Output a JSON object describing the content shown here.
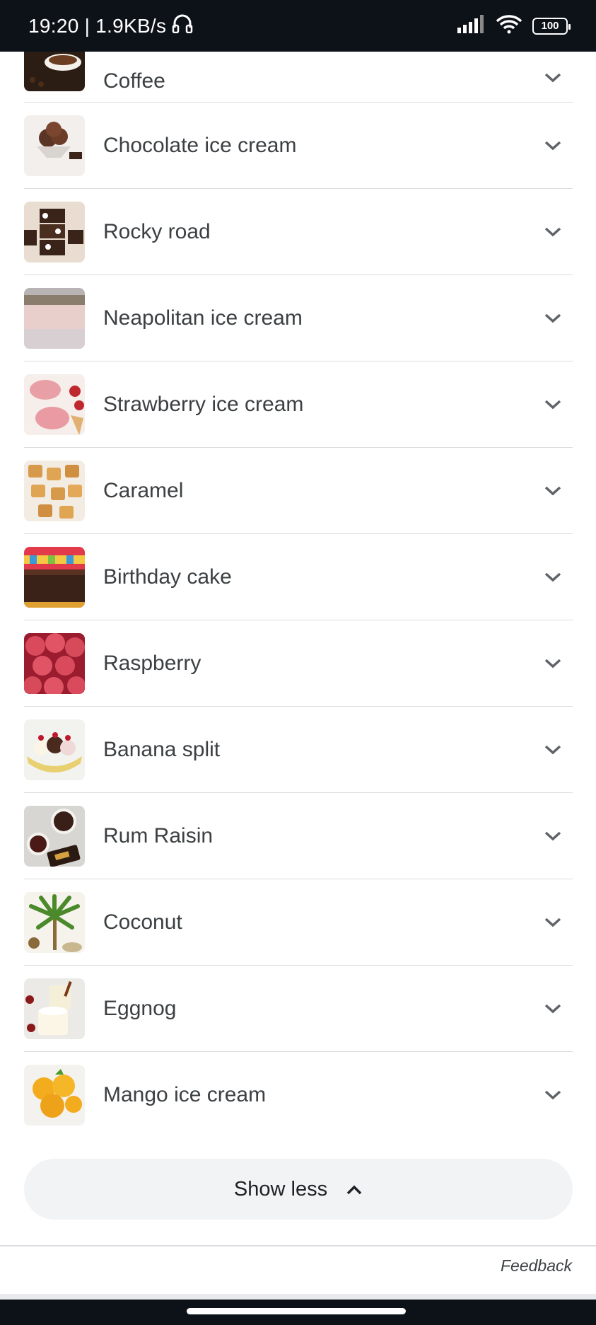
{
  "status_bar": {
    "time": "19:20",
    "separator": "|",
    "net_speed": "1.9KB/s",
    "battery": "100"
  },
  "flavors": [
    {
      "label": "Coffee",
      "icon": "coffee-thumbnail"
    },
    {
      "label": "Chocolate ice cream",
      "icon": "chocolate-ice-cream-thumbnail"
    },
    {
      "label": "Rocky road",
      "icon": "rocky-road-thumbnail"
    },
    {
      "label": "Neapolitan ice cream",
      "icon": "neapolitan-ice-cream-thumbnail"
    },
    {
      "label": "Strawberry ice cream",
      "icon": "strawberry-ice-cream-thumbnail"
    },
    {
      "label": "Caramel",
      "icon": "caramel-thumbnail"
    },
    {
      "label": "Birthday cake",
      "icon": "birthday-cake-thumbnail"
    },
    {
      "label": "Raspberry",
      "icon": "raspberry-thumbnail"
    },
    {
      "label": "Banana split",
      "icon": "banana-split-thumbnail"
    },
    {
      "label": "Rum Raisin",
      "icon": "rum-raisin-thumbnail"
    },
    {
      "label": "Coconut",
      "icon": "coconut-thumbnail"
    },
    {
      "label": "Eggnog",
      "icon": "eggnog-thumbnail"
    },
    {
      "label": "Mango ice cream",
      "icon": "mango-ice-cream-thumbnail"
    }
  ],
  "show_less_label": "Show less",
  "feedback_label": "Feedback",
  "colors": {
    "status_bar_bg": "#0d1118",
    "text": "#3c4043",
    "divider": "#dadce0",
    "button_bg": "#f1f3f4",
    "chevron": "#5f6368"
  }
}
